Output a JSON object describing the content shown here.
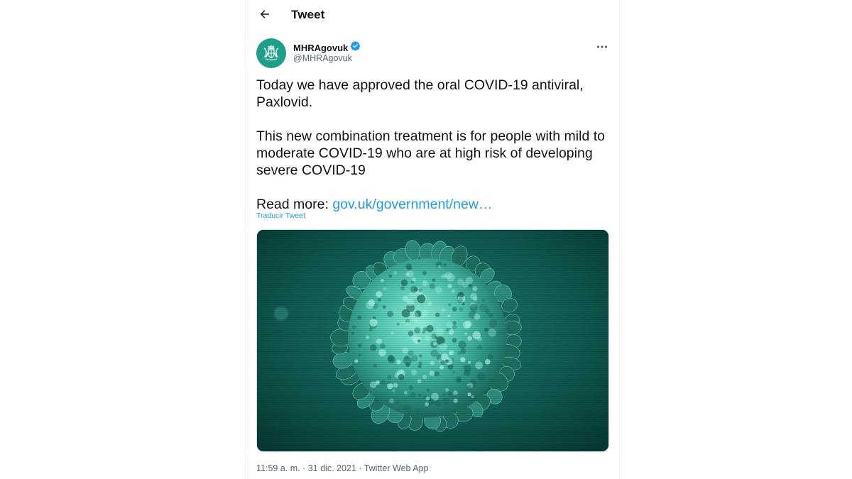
{
  "header": {
    "title": "Tweet"
  },
  "author": {
    "name": "MHRAgovuk",
    "handle": "@MHRAgovuk",
    "verified": true
  },
  "tweet": {
    "paragraph1": "Today we have approved the oral COVID-19 antiviral, Paxlovid.",
    "paragraph2": "This new combination treatment is for people with mild to moderate COVID-19 who are at high risk of developing severe COVID-19",
    "read_more_prefix": "Read more: ",
    "link_text": "gov.uk/government/new…",
    "translate_label": "Traducir Tweet"
  },
  "meta": {
    "timestamp": "11:59 a. m. · 31 dic. 2021 · Twitter Web App"
  },
  "colors": {
    "link": "#1d9bf0",
    "verified_badge": "#1d9bf0",
    "avatar_bg": "#1e9f8a",
    "media_bg": "#0d4f47"
  },
  "icons": {
    "back": "arrow-left-icon",
    "verified": "verified-badge-icon",
    "more": "more-horizontal-icon",
    "avatar": "royal-coat-of-arms-icon"
  }
}
